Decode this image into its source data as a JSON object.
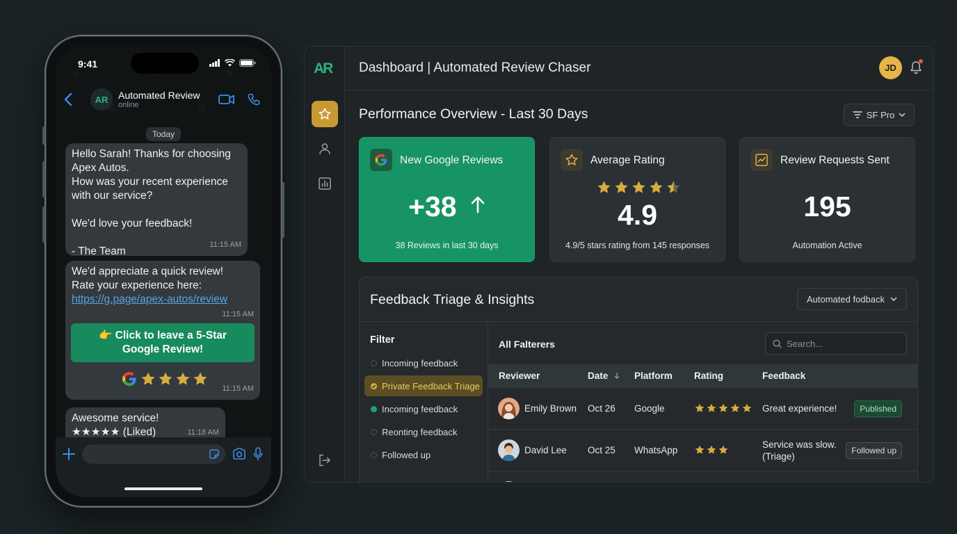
{
  "phone": {
    "time": "9:41",
    "chat_name": "Automated Review",
    "chat_status": "online",
    "avatar_text": "AR",
    "date_chip": "Today",
    "messages": [
      {
        "text": "Hello Sarah! Thanks for choosing\nApex Autos.\nHow was your recent experience\nwith our service?\n\nWe'd love your feedback!\n\n- The Team",
        "time": "11:15 AM"
      },
      {
        "text": "We'd appreciate a quick review!\nRate your experience here:",
        "link": "https://g.page/apex-autos/review",
        "time": "11:15 AM",
        "cta": "👉 Click to leave a 5-Star\nGoogle Review!",
        "cta_time": "11:15 AM",
        "star_count": 4
      },
      {
        "text": "Awesome service!",
        "stars_text": "★★★★★ (Liked)",
        "time": "11:18 AM"
      }
    ]
  },
  "dashboard": {
    "logo": "AR",
    "title": "Dashboard | Automated Review Chaser",
    "user_initials": "JD",
    "section_title": "Performance Overview - Last 30 Days",
    "font_select": "SF Pro",
    "cards": [
      {
        "label": "New Google Reviews",
        "value": "+38",
        "sub": "38 Reviews in last 30 days"
      },
      {
        "label": "Average Rating",
        "value": "4.9",
        "sub": "4.9/5 stars rating from 145 responses",
        "stars": 4.5
      },
      {
        "label": "Review Requests Sent",
        "value": "195",
        "sub": "Automation Active"
      }
    ],
    "triage": {
      "title": "Feedback Triage & Insights",
      "select": "Automated fodback",
      "filter_head": "Filter",
      "filters": [
        {
          "label": "Incoming feedback",
          "state": "none"
        },
        {
          "label": "Private Feedback Triage",
          "state": "selected"
        },
        {
          "label": "Incoming feedback",
          "state": "green"
        },
        {
          "label": "Reonting feedback",
          "state": "none"
        },
        {
          "label": "Followed up",
          "state": "none"
        }
      ],
      "table_title": "All Falterers",
      "search_placeholder": "Search...",
      "columns": [
        "Reviewer",
        "Date",
        "Platform",
        "Rating",
        "Feedback"
      ],
      "rows": [
        {
          "reviewer": "Emily Brown",
          "date": "Oct 26",
          "platform": "Google",
          "rating": 5,
          "feedback": "Great experience!",
          "status": "Published"
        },
        {
          "reviewer": "David Lee",
          "date": "Oct 25",
          "platform": "WhatsApp",
          "rating": 3,
          "feedback": "Service was slow.\n(Triage)",
          "status": "Followed up"
        }
      ]
    }
  },
  "colors": {
    "accent_green": "#179463",
    "gold": "#d7ad3f",
    "background": "#1b2326"
  }
}
